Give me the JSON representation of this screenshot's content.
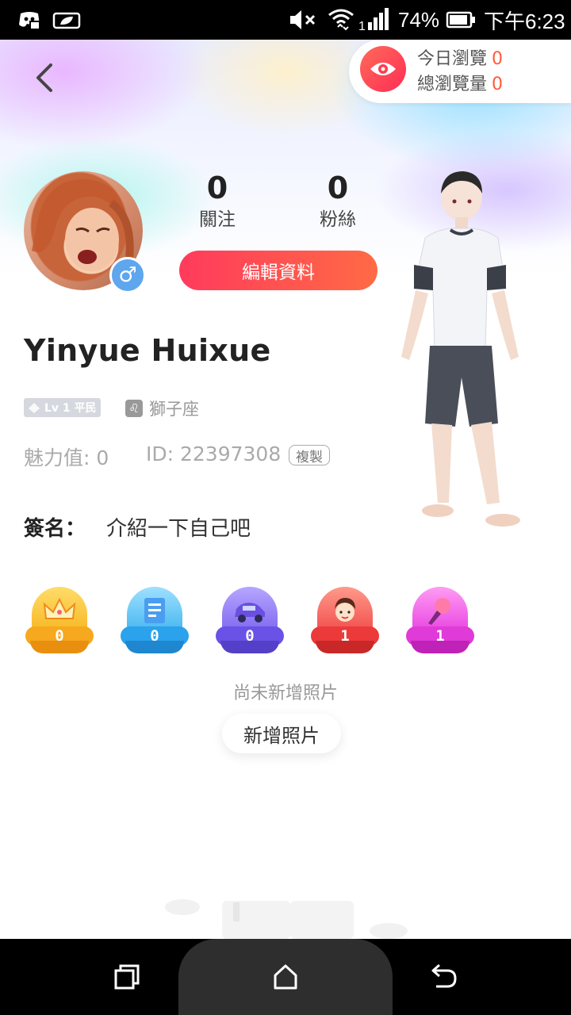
{
  "status_bar": {
    "battery_percent": "74%",
    "time": "下午6:23",
    "icons": [
      "discord-icon",
      "leaf-icon",
      "mute-icon",
      "wifi-icon",
      "signal-icon",
      "battery-icon"
    ]
  },
  "header": {
    "back_icon": "chevron-left-icon",
    "views": {
      "today_label": "今日瀏覽",
      "today_count": "0",
      "total_label": "總瀏覽量",
      "total_count": "0"
    }
  },
  "profile": {
    "gender_symbol": "♂",
    "following": {
      "count": "0",
      "label": "關注"
    },
    "followers": {
      "count": "0",
      "label": "粉絲"
    },
    "edit_button": "編輯資料",
    "username": "Yinyue Huixue",
    "level_badge": "Lv 1 平民",
    "zodiac_symbol": "♌",
    "zodiac": "獅子座",
    "charm": "魅力值: 0",
    "id": "ID: 22397308",
    "copy_button": "複製",
    "signature_label": "簽名：",
    "signature_value": "介紹一下自己吧"
  },
  "medals": [
    {
      "name": "crown",
      "count": "0",
      "color": "#f6b51e"
    },
    {
      "name": "document",
      "count": "0",
      "color": "#3fb3ee"
    },
    {
      "name": "car",
      "count": "0",
      "color": "#7b63ee"
    },
    {
      "name": "person",
      "count": "1",
      "color": "#f04848"
    },
    {
      "name": "microphone",
      "count": "1",
      "color": "#e63ee0"
    }
  ],
  "photos": {
    "empty_text": "尚未新增照片",
    "add_button": "新增照片"
  },
  "colors": {
    "accent_start": "#ff3b5c",
    "accent_end": "#ff6a45",
    "view_count": "#ff5a3c",
    "muted_text": "#aaaaaa"
  }
}
